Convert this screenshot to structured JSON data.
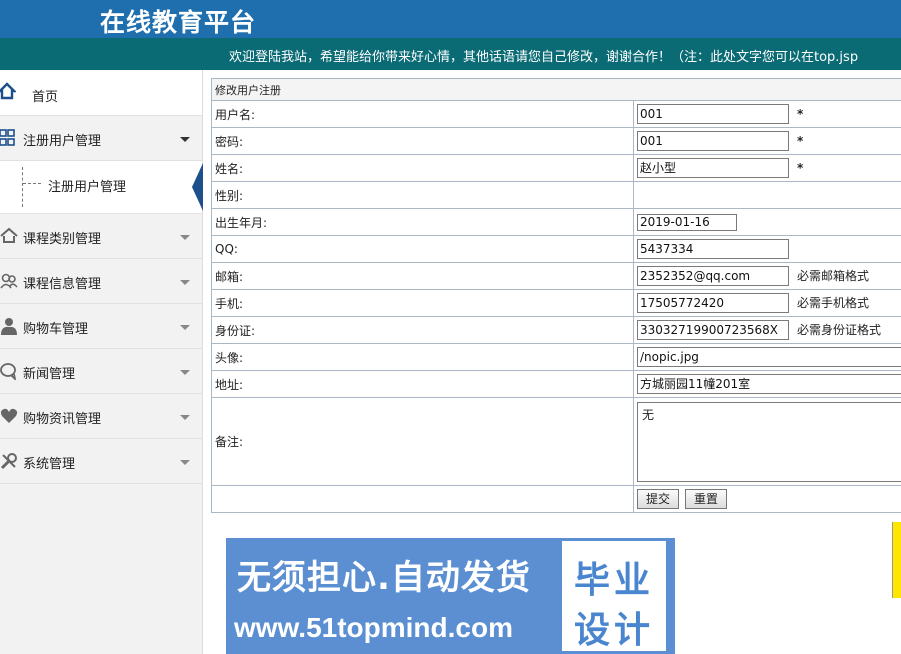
{
  "header": {
    "title": "在线教育平台",
    "welcome": "欢迎登陆我站，希望能给你带来好心情，其他话语请您自己修改，谢谢合作！（注：此处文字您可以在top.jsp"
  },
  "sidebar": {
    "home": "首页",
    "items": [
      {
        "label": "注册用户管理",
        "icon": "grid-icon"
      },
      {
        "label": "课程类别管理",
        "icon": "home-icon"
      },
      {
        "label": "课程信息管理",
        "icon": "users-icon"
      },
      {
        "label": "购物车管理",
        "icon": "user-icon"
      },
      {
        "label": "新闻管理",
        "icon": "chat-icon"
      },
      {
        "label": "购物资讯管理",
        "icon": "heart-icon"
      },
      {
        "label": "系统管理",
        "icon": "tools-icon"
      }
    ],
    "sub_item": "注册用户管理"
  },
  "form": {
    "caption": "修改用户注册",
    "fields": {
      "username": {
        "label": "用户名:",
        "value": "001",
        "mark": "*"
      },
      "password": {
        "label": "密码:",
        "value": "001",
        "mark": "*"
      },
      "name": {
        "label": "姓名:",
        "value": "赵小型",
        "mark": "*"
      },
      "gender": {
        "label": "性别:"
      },
      "birth": {
        "label": "出生年月:",
        "value": "2019-01-16"
      },
      "qq": {
        "label": "QQ:",
        "value": "5437334"
      },
      "email": {
        "label": "邮箱:",
        "value": "2352352@qq.com",
        "hint": "必需邮箱格式"
      },
      "phone": {
        "label": "手机:",
        "value": "17505772420",
        "hint": "必需手机格式"
      },
      "idcard": {
        "label": "身份证:",
        "value": "33032719900723568X",
        "hint": "必需身份证格式"
      },
      "avatar": {
        "label": "头像:",
        "value": "/nopic.jpg"
      },
      "address": {
        "label": "地址:",
        "value": "方城丽园11幢201室"
      },
      "remark": {
        "label": "备注:",
        "value": "无"
      }
    },
    "submit": "提交",
    "reset": "重置"
  },
  "ad": {
    "line1": "无须担心.自动发货",
    "line2": "www.51topmind.com",
    "badge1": "毕业",
    "badge2": "设计"
  }
}
